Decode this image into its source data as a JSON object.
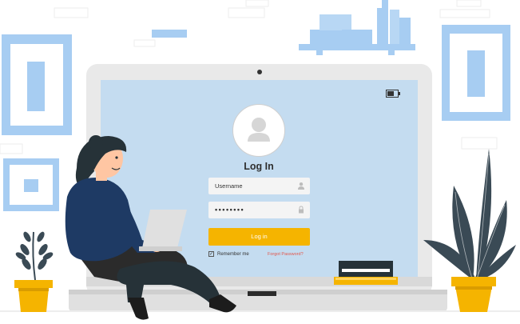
{
  "login": {
    "title": "Log In",
    "username_placeholder": "Username",
    "password_value": "••••••••",
    "login_button": "Log in",
    "remember_label": "Remember me",
    "forgot_link": "Forgot Password?"
  },
  "colors": {
    "screen": "#c4dcf0",
    "accent": "#f5b400",
    "frame": "#a7cdf2",
    "shirt": "#1e3a64",
    "pants": "#2b2b2b",
    "plant": "#3a4a55",
    "link": "#e2574c"
  },
  "icons": [
    "user-avatar-icon",
    "user-icon",
    "lock-icon",
    "battery-icon",
    "check-icon"
  ]
}
